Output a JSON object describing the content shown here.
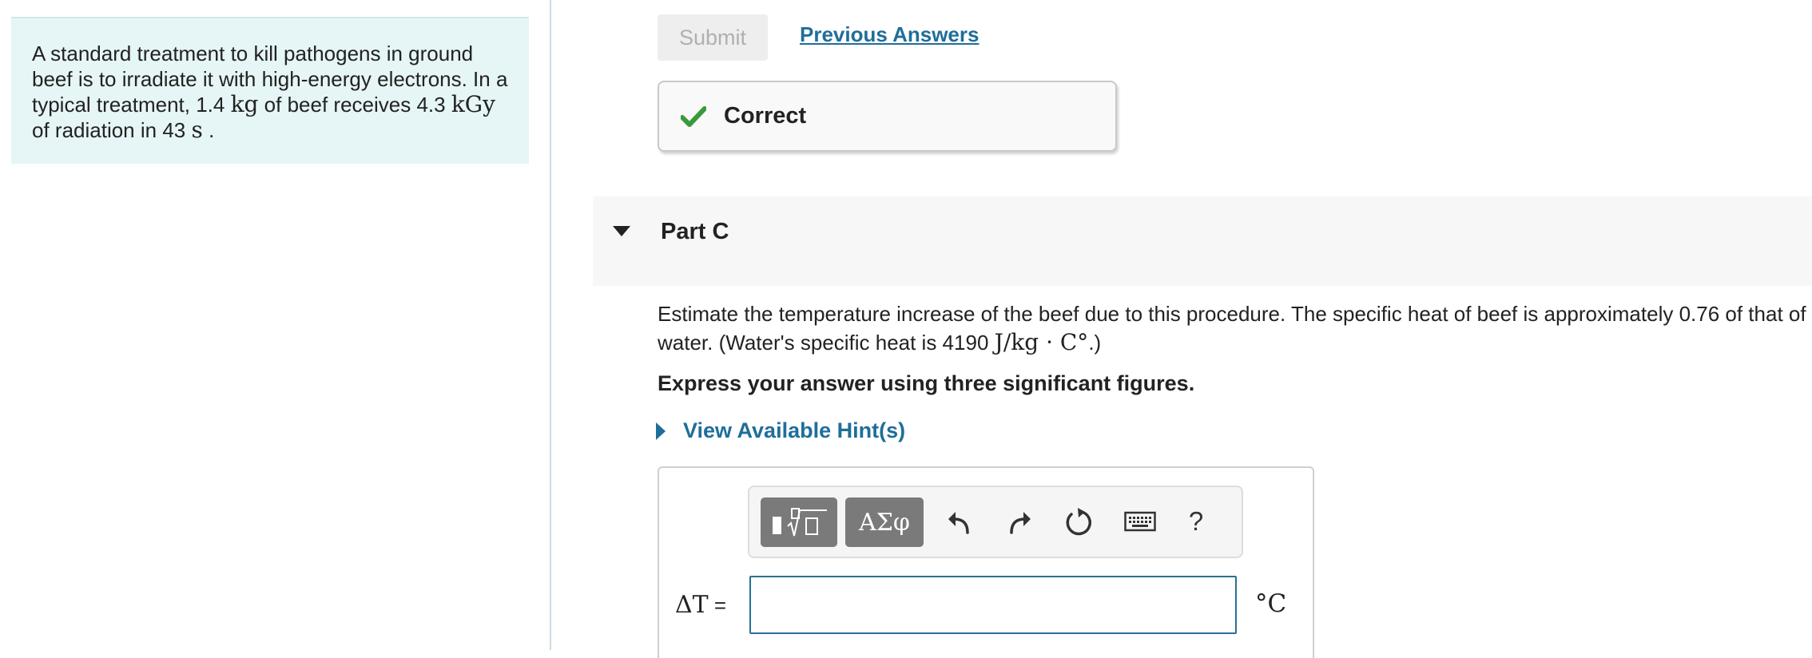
{
  "problem": {
    "text_1": "A standard treatment to kill pathogens in ground beef is to irradiate it with high-energy electrons. In a typical treatment, 1.4 ",
    "mass_unit": "kg",
    "text_2": " of beef receives 4.3 ",
    "dose_unit": "kGy",
    "text_3": " of radiation in 43 ",
    "time_unit": "s",
    "text_4": " ."
  },
  "submit": {
    "label": "Submit"
  },
  "previous_answers": {
    "label": "Previous Answers"
  },
  "feedback": {
    "text": "Correct",
    "icon": "check-icon",
    "color": "#3a9a3a"
  },
  "part": {
    "title": "Part C"
  },
  "question": {
    "text_1": "Estimate the temperature increase of the beef due to this procedure. The specific heat of beef is approximately 0.76 of that of water.  (Water's specific heat is 4190 ",
    "unit": "J/kg · C°",
    "text_2": ".)",
    "instruction": "Express your answer using three significant figures."
  },
  "hints": {
    "label": "View Available Hint(s)"
  },
  "toolbar": {
    "templates_icon": "templates-icon",
    "symbols_label": "ΑΣφ",
    "undo_icon": "undo-icon",
    "redo_icon": "redo-icon",
    "reset_icon": "reset-icon",
    "keyboard_icon": "keyboard-icon",
    "help_label": "?"
  },
  "answer": {
    "label_symbol": "ΔT",
    "label_eq": " =",
    "value": "",
    "unit": "°C"
  },
  "colors": {
    "link": "#1f6e9a",
    "input_border": "#2a6f96",
    "panel_bg": "#e6f5f5"
  }
}
